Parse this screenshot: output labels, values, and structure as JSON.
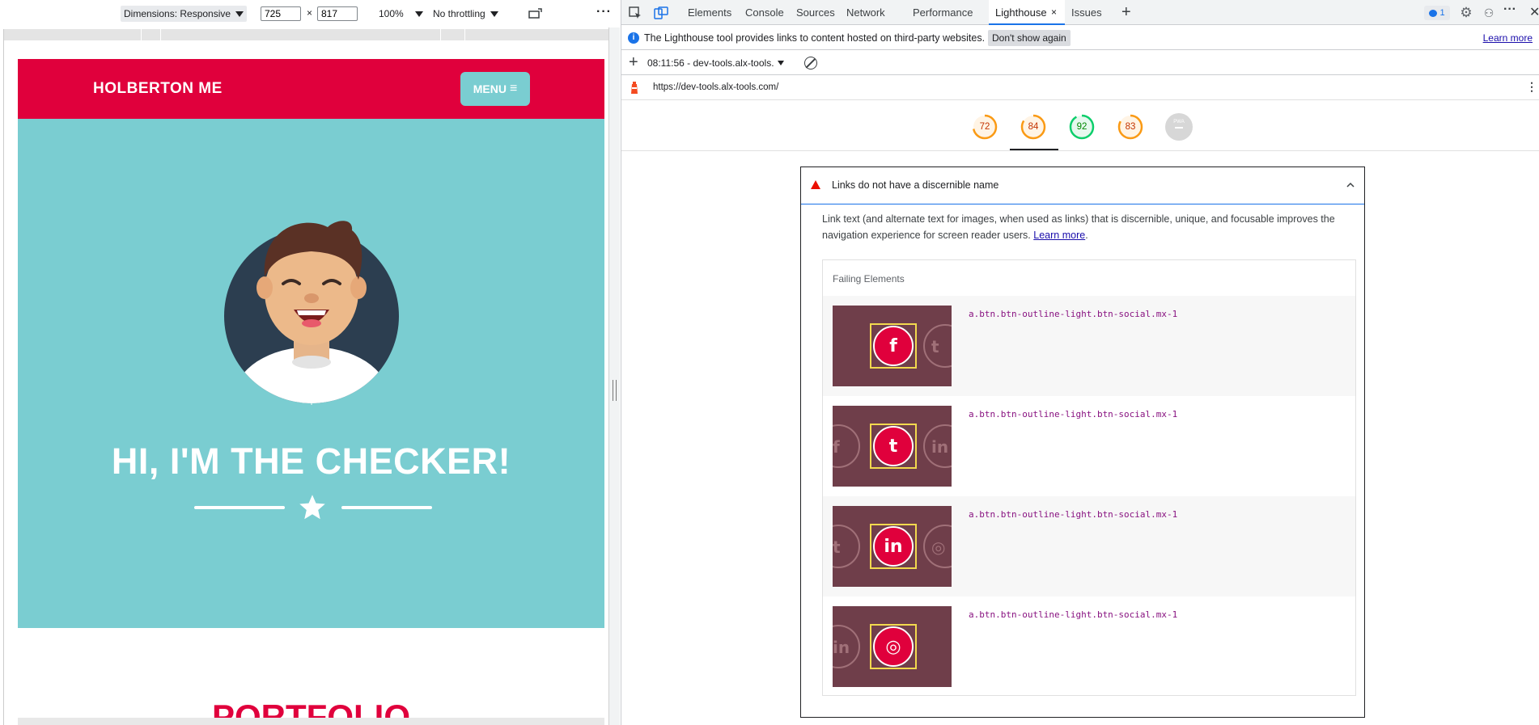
{
  "device_toolbar": {
    "dimensions_label": "Dimensions: Responsive",
    "width_value": "725",
    "times": "×",
    "height_value": "817",
    "zoom": "100%",
    "throttling": "No throttling",
    "more": "⋮"
  },
  "site": {
    "brand": "HOLBERTON ME",
    "menu_label": "MENU",
    "menu_icon": "≡",
    "hero_title": "HI, I'M THE CHECKER!",
    "section_title": "PORTFOLIO",
    "colors": {
      "primary": "#e0003c",
      "masthead": "#7acdd1"
    }
  },
  "devtools": {
    "tabs": [
      "Elements",
      "Console",
      "Sources",
      "Network",
      "Performance",
      "Lighthouse",
      "Issues"
    ],
    "active_tab": "Lighthouse",
    "issues_badge": "1",
    "info_message": "The Lighthouse tool provides links to content hosted on third-party websites.",
    "dont_show": "Don't show again",
    "learn_more": "Learn more",
    "report_label": "08:11:56 - dev-tools.alx-tools.",
    "url": "https://dev-tools.alx-tools.com/",
    "scores": [
      {
        "value": "72",
        "color": "#fa9a14"
      },
      {
        "value": "84",
        "color": "#fa9a14"
      },
      {
        "value": "92",
        "color": "#0cce6b"
      },
      {
        "value": "83",
        "color": "#fa9a14"
      }
    ],
    "pwa_label": "PWA"
  },
  "audit": {
    "title": "Links do not have a discernible name",
    "description": "Link text (and alternate text for images, when used as links) that is discernible, unique, and focusable improves the navigation experience for screen reader users.",
    "learn_more": "Learn more",
    "failing_label": "Failing Elements",
    "items": [
      {
        "selector": "a.btn.btn-outline-light.btn-social.mx-1",
        "icon": "f",
        "left": "",
        "right": "t"
      },
      {
        "selector": "a.btn.btn-outline-light.btn-social.mx-1",
        "icon": "t",
        "left": "f",
        "right": "in"
      },
      {
        "selector": "a.btn.btn-outline-light.btn-social.mx-1",
        "icon": "in",
        "left": "t",
        "right": "◎"
      },
      {
        "selector": "a.btn.btn-outline-light.btn-social.mx-1",
        "icon": "◎",
        "left": "in",
        "right": ""
      }
    ]
  }
}
